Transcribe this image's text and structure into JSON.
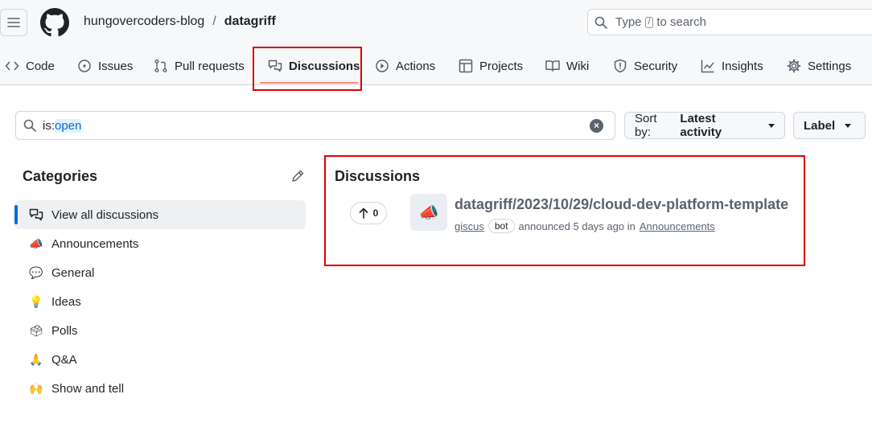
{
  "header": {
    "owner": "hungovercoders-blog",
    "separator": "/",
    "repo": "datagriff",
    "search_placeholder_before": "Type",
    "search_key": "/",
    "search_placeholder_after": "to search"
  },
  "tabs": [
    {
      "label": "Code",
      "icon": "code-icon"
    },
    {
      "label": "Issues",
      "icon": "issue-icon"
    },
    {
      "label": "Pull requests",
      "icon": "pull-request-icon"
    },
    {
      "label": "Discussions",
      "icon": "discussion-icon",
      "selected": true
    },
    {
      "label": "Actions",
      "icon": "play-icon"
    },
    {
      "label": "Projects",
      "icon": "table-icon"
    },
    {
      "label": "Wiki",
      "icon": "book-icon"
    },
    {
      "label": "Security",
      "icon": "shield-icon"
    },
    {
      "label": "Insights",
      "icon": "graph-icon"
    },
    {
      "label": "Settings",
      "icon": "gear-icon"
    }
  ],
  "filter": {
    "query_key": "is:",
    "query_value": "open",
    "sort_label": "Sort by:",
    "sort_value": "Latest activity",
    "label_button": "Label"
  },
  "sidebar": {
    "title": "Categories",
    "items": [
      {
        "label": "View all discussions",
        "icon": "discussion-icon",
        "active": true
      },
      {
        "label": "Announcements",
        "emoji": "📣"
      },
      {
        "label": "General",
        "emoji": "💬"
      },
      {
        "label": "Ideas",
        "emoji": "💡"
      },
      {
        "label": "Polls",
        "emoji": "🗳"
      },
      {
        "label": "Q&A",
        "emoji": "🙏"
      },
      {
        "label": "Show and tell",
        "emoji": "🙌"
      }
    ]
  },
  "discussions": {
    "title": "Discussions",
    "items": [
      {
        "votes": "0",
        "emoji": "📣",
        "title": "datagriff/2023/10/29/cloud-dev-platform-template",
        "author": "giscus",
        "badge": "bot",
        "action": "announced 5 days ago in",
        "category": "Announcements"
      }
    ]
  },
  "colors": {
    "highlight": "#dd0000",
    "accent": "#0969da",
    "tab_underline": "#fd8c73"
  }
}
